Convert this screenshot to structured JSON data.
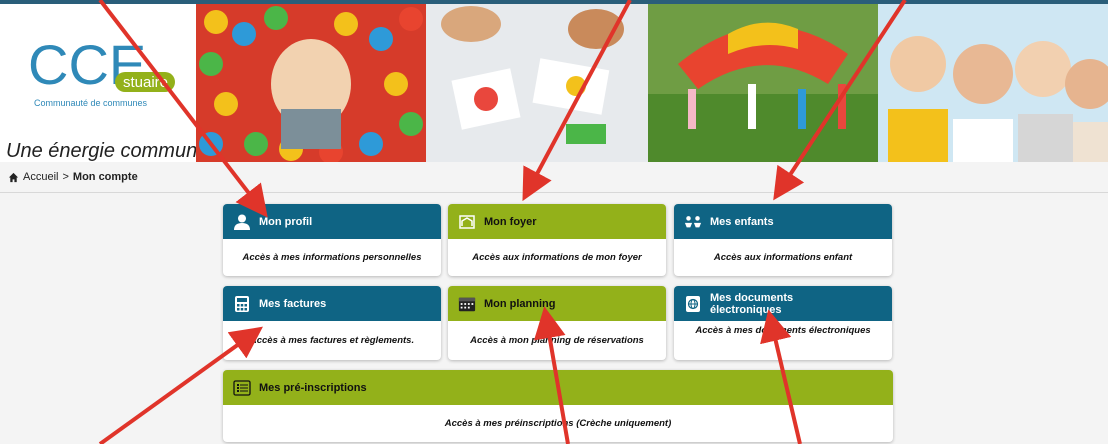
{
  "header": {
    "logo_text": "CCE",
    "logo_suffix": "stuaire",
    "logo_caption": "Communauté de communes",
    "tagline": "Une énergie commune"
  },
  "breadcrumb": {
    "home": "Accueil",
    "separator": ">",
    "current": "Mon compte"
  },
  "colors": {
    "blue": "#0f6484",
    "green": "#93b11a",
    "arrow": "#e0342a"
  },
  "cards": {
    "profil": {
      "title": "Mon profil",
      "desc": "Accès à mes informations personnelles",
      "icon": "user-icon"
    },
    "foyer": {
      "title": "Mon foyer",
      "desc": "Accès aux informations de mon foyer",
      "icon": "home-icon"
    },
    "enfants": {
      "title": "Mes enfants",
      "desc": "Accès aux informations enfant",
      "icon": "children-icon"
    },
    "factures": {
      "title": "Mes factures",
      "desc": "Accès à mes factures et règlements.",
      "icon": "calculator-icon"
    },
    "planning": {
      "title": "Mon planning",
      "desc": "Accès à mon planning de réservations",
      "icon": "calendar-icon"
    },
    "documents": {
      "title_line1": "Mes documents",
      "title_line2": "électroniques",
      "desc": "Accès à mes documents électroniques",
      "icon": "globe-document-icon"
    },
    "preinscriptions": {
      "title": "Mes pré-inscriptions",
      "desc": "Accès à mes préinscriptions (Crèche uniquement)",
      "icon": "list-icon"
    }
  }
}
